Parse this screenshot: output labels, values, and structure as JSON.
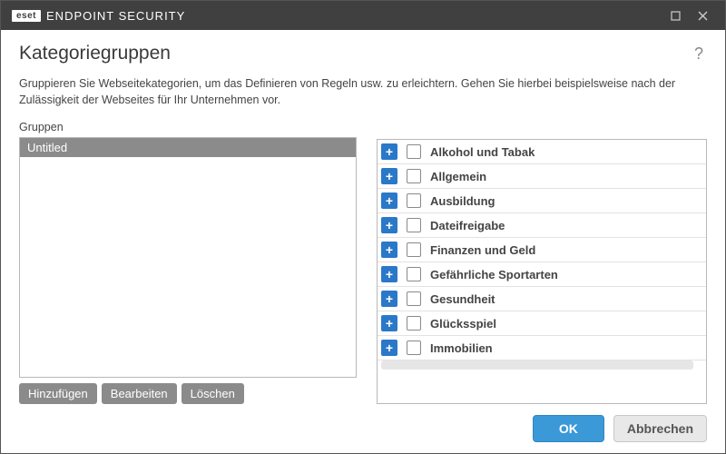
{
  "brand": "eset",
  "product": "ENDPOINT SECURITY",
  "heading": "Kategoriegruppen",
  "description": "Gruppieren Sie Webseitekategorien, um das Definieren von Regeln usw. zu erleichtern. Gehen Sie hierbei beispielsweise nach der Zulässigkeit der Webseites für Ihr Unternehmen vor.",
  "groupsLabel": "Gruppen",
  "groups": [
    {
      "name": "Untitled",
      "selected": true
    }
  ],
  "leftButtons": {
    "add": "Hinzufügen",
    "edit": "Bearbeiten",
    "delete": "Löschen"
  },
  "categories": [
    "Alkohol und Tabak",
    "Allgemein",
    "Ausbildung",
    "Dateifreigabe",
    "Finanzen und Geld",
    "Gefährliche Sportarten",
    "Gesundheit",
    "Glücksspiel",
    "Immobilien"
  ],
  "footer": {
    "ok": "OK",
    "cancel": "Abbrechen"
  },
  "helpTooltip": "?"
}
